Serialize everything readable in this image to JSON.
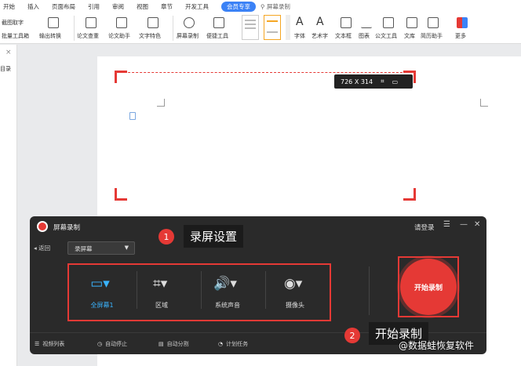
{
  "menu": {
    "tabs": [
      "开始",
      "插入",
      "页面布局",
      "引用",
      "审阅",
      "视图",
      "章节",
      "开发工具"
    ],
    "vip": "会员专享",
    "search": "屏幕录制"
  },
  "ribbon": {
    "screenshot": "截图取字",
    "batch": "批量工具箱",
    "convert": "输出转换",
    "paper_check": "论文查重",
    "paper_help": "论文助手",
    "text_feature": "文字特色",
    "screen_record": "屏幕录制",
    "quick_tools": "便捷工具",
    "font": "字体",
    "art_text": "艺术字",
    "text_box": "文本框",
    "chart": "图表",
    "doc_table": "公文工具",
    "library": "文库",
    "resume": "简历助手",
    "more": "更多"
  },
  "left": {
    "close": "×",
    "label": "目录"
  },
  "capture": {
    "size": "726 X 314"
  },
  "recorder": {
    "title": "屏幕录制",
    "login": "请登录",
    "back": "返回",
    "mode": "录屏幕",
    "options": [
      {
        "label": "全屏幕1",
        "icon": "monitor-icon"
      },
      {
        "label": "区域",
        "icon": "crop-icon"
      },
      {
        "label": "系统声音",
        "icon": "speaker-icon"
      },
      {
        "label": "摄像头",
        "icon": "camera-icon"
      }
    ],
    "start": "开始录制",
    "footer": [
      "视频列表",
      "自动停止",
      "自动分割",
      "计划任务"
    ]
  },
  "callouts": {
    "one_num": "1",
    "one_text": "录屏设置",
    "two_num": "2",
    "two_text": "开始录制"
  },
  "watermark": "@数据蛙恢复软件",
  "colors": {
    "accent_red": "#e53935",
    "accent_blue": "#3ab4ff",
    "panel_bg": "#2a2a2a"
  }
}
